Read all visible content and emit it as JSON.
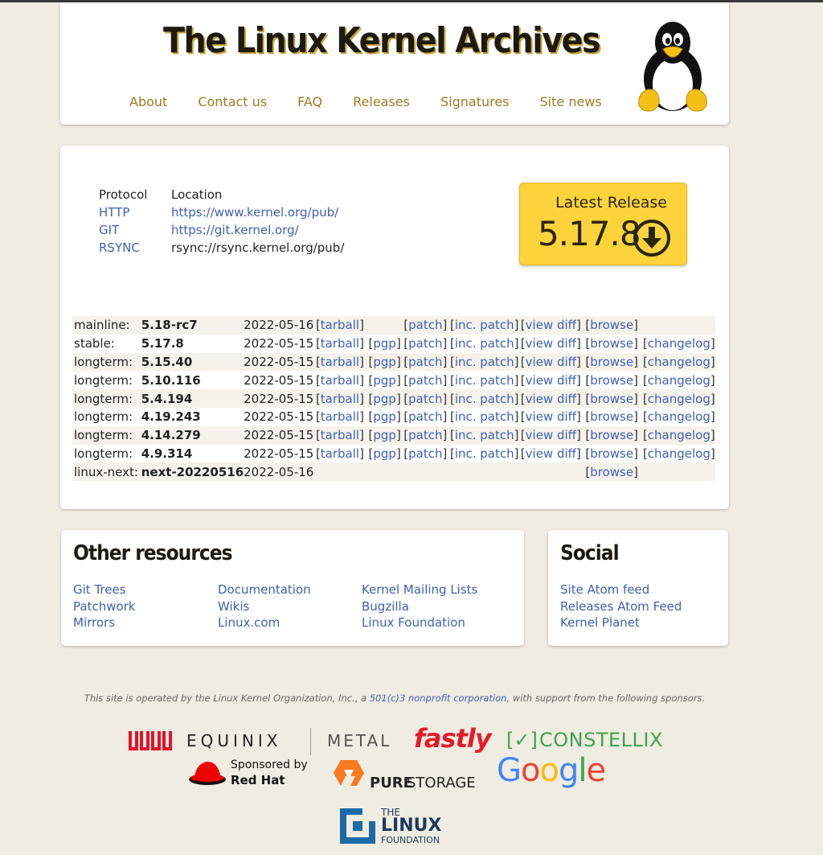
{
  "header": {
    "title": "The Linux Kernel Archives",
    "nav": [
      "About",
      "Contact us",
      "FAQ",
      "Releases",
      "Signatures",
      "Site news"
    ]
  },
  "protocols": {
    "headers": [
      "Protocol",
      "Location"
    ],
    "rows": [
      {
        "protocol": "HTTP",
        "location": "https://www.kernel.org/pub/",
        "linked": true
      },
      {
        "protocol": "GIT",
        "location": "https://git.kernel.org/",
        "linked": true
      },
      {
        "protocol": "RSYNC",
        "location": "rsync://rsync.kernel.org/pub/",
        "linked": false
      }
    ]
  },
  "latest": {
    "label": "Latest Release",
    "version": "5.17.8",
    "icon": "download-circle-icon"
  },
  "releases": [
    {
      "kind": "mainline:",
      "version": "5.18-rc7",
      "date": "2022-05-16",
      "tarball": "tarball",
      "pgp": "",
      "patch": "patch",
      "inc_patch": "inc. patch",
      "view_diff": "view diff",
      "browse": "browse",
      "changelog": ""
    },
    {
      "kind": "stable:",
      "version": "5.17.8",
      "date": "2022-05-15",
      "tarball": "tarball",
      "pgp": "pgp",
      "patch": "patch",
      "inc_patch": "inc. patch",
      "view_diff": "view diff",
      "browse": "browse",
      "changelog": "changelog"
    },
    {
      "kind": "longterm:",
      "version": "5.15.40",
      "date": "2022-05-15",
      "tarball": "tarball",
      "pgp": "pgp",
      "patch": "patch",
      "inc_patch": "inc. patch",
      "view_diff": "view diff",
      "browse": "browse",
      "changelog": "changelog"
    },
    {
      "kind": "longterm:",
      "version": "5.10.116",
      "date": "2022-05-15",
      "tarball": "tarball",
      "pgp": "pgp",
      "patch": "patch",
      "inc_patch": "inc. patch",
      "view_diff": "view diff",
      "browse": "browse",
      "changelog": "changelog"
    },
    {
      "kind": "longterm:",
      "version": "5.4.194",
      "date": "2022-05-15",
      "tarball": "tarball",
      "pgp": "pgp",
      "patch": "patch",
      "inc_patch": "inc. patch",
      "view_diff": "view diff",
      "browse": "browse",
      "changelog": "changelog"
    },
    {
      "kind": "longterm:",
      "version": "4.19.243",
      "date": "2022-05-15",
      "tarball": "tarball",
      "pgp": "pgp",
      "patch": "patch",
      "inc_patch": "inc. patch",
      "view_diff": "view diff",
      "browse": "browse",
      "changelog": "changelog"
    },
    {
      "kind": "longterm:",
      "version": "4.14.279",
      "date": "2022-05-15",
      "tarball": "tarball",
      "pgp": "pgp",
      "patch": "patch",
      "inc_patch": "inc. patch",
      "view_diff": "view diff",
      "browse": "browse",
      "changelog": "changelog"
    },
    {
      "kind": "longterm:",
      "version": "4.9.314",
      "date": "2022-05-15",
      "tarball": "tarball",
      "pgp": "pgp",
      "patch": "patch",
      "inc_patch": "inc. patch",
      "view_diff": "view diff",
      "browse": "browse",
      "changelog": "changelog"
    },
    {
      "kind": "linux-next:",
      "version": "next-20220516",
      "date": "2022-05-16",
      "tarball": "",
      "pgp": "",
      "patch": "",
      "inc_patch": "",
      "view_diff": "",
      "browse": "browse",
      "changelog": ""
    }
  ],
  "resources": {
    "title": "Other resources",
    "columns": [
      [
        "Git Trees",
        "Patchwork",
        "Mirrors"
      ],
      [
        "Documentation",
        "Wikis",
        "Linux.com"
      ],
      [
        "Kernel Mailing Lists",
        "Bugzilla",
        "Linux Foundation"
      ]
    ]
  },
  "social": {
    "title": "Social",
    "links": [
      "Site Atom feed",
      "Releases Atom Feed",
      "Kernel Planet"
    ]
  },
  "footer": {
    "text_before": "This site is operated by the Linux Kernel Organization, Inc., a ",
    "link": "501(c)3 nonprofit corporation",
    "text_after": ", with support from the following sponsors."
  },
  "sponsors": {
    "equinix": "EQUINIX",
    "metal": "METAL",
    "fastly": "fastly",
    "constellix": "CONSTELLIX",
    "redhat_line1": "Sponsored by",
    "redhat_line2": "Red Hat",
    "pure": "PURE",
    "storage": "STORAGE",
    "google": [
      "G",
      "o",
      "o",
      "g",
      "l",
      "e"
    ],
    "lf_the": "THE",
    "lf_linux": "LINUX",
    "lf_foundation": "FOUNDATION"
  },
  "colors": {
    "background": "#efece1",
    "nav": "#9b7b22",
    "link": "#3d5fb6",
    "latest_bg": "#fcd33a"
  }
}
